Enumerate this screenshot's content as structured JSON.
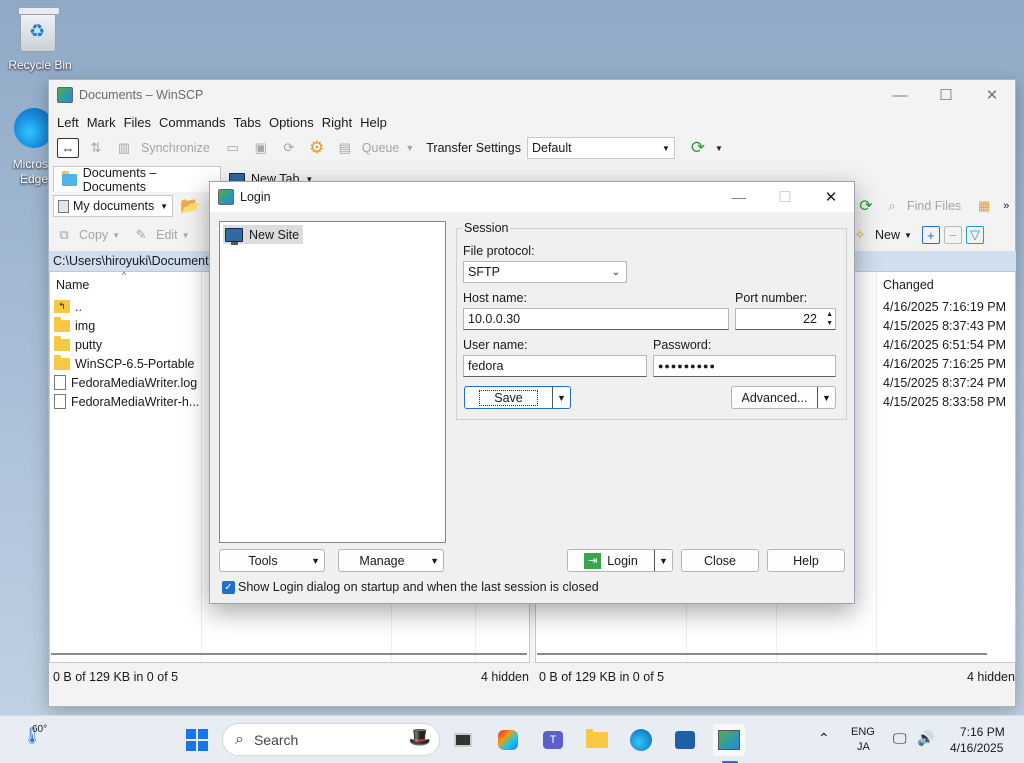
{
  "desktop": {
    "recycle_bin_label": "Recycle Bin",
    "edge_label_line1": "Micros",
    "edge_label_line2": "Edge"
  },
  "window": {
    "title": "Documents – WinSCP",
    "menu": [
      "Left",
      "Mark",
      "Files",
      "Commands",
      "Tabs",
      "Options",
      "Right",
      "Help"
    ],
    "toolbar": {
      "synchronize": "Synchronize",
      "queue": "Queue",
      "transfer_settings_label": "Transfer Settings",
      "transfer_settings_value": "Default"
    },
    "tabs": {
      "active": "Documents – Documents",
      "new_tab": "New Tab"
    },
    "left_panel": {
      "location": "My documents",
      "copy": "Copy",
      "edit": "Edit",
      "path": "C:\\Users\\hiroyuki\\Documents",
      "col_name": "Name",
      "files": [
        {
          "name": "..",
          "kind": "up"
        },
        {
          "name": "img",
          "kind": "folder"
        },
        {
          "name": "putty",
          "kind": "folder"
        },
        {
          "name": "WinSCP-6.5-Portable",
          "kind": "folder"
        },
        {
          "name": "FedoraMediaWriter.log",
          "kind": "file"
        },
        {
          "name": "FedoraMediaWriter-h...",
          "kind": "file"
        }
      ],
      "status": "0 B of 129 KB in 0 of 5",
      "hidden": "4 hidden"
    },
    "right_panel": {
      "find_files": "Find Files",
      "new": "New",
      "col_changed": "Changed",
      "changed": [
        "4/16/2025 7:16:19 PM",
        "4/15/2025 8:37:43 PM",
        "4/16/2025 6:51:54 PM",
        "4/16/2025 7:16:25 PM",
        "4/15/2025 8:37:24 PM",
        "4/15/2025 8:33:58 PM"
      ],
      "status": "0 B of 129 KB in 0 of 5",
      "hidden": "4 hidden"
    }
  },
  "login": {
    "title": "Login",
    "sites": [
      "New Site"
    ],
    "session_group": "Session",
    "file_protocol_label": "File protocol:",
    "file_protocol_value": "SFTP",
    "host_label": "Host name:",
    "host_value": "10.0.0.30",
    "port_label": "Port number:",
    "port_value": "22",
    "user_label": "User name:",
    "user_value": "fedora",
    "password_label": "Password:",
    "password_value": "●●●●●●●●●",
    "save": "Save",
    "advanced": "Advanced...",
    "tools": "Tools",
    "manage": "Manage",
    "login_btn": "Login",
    "close": "Close",
    "help": "Help",
    "show_login_checkbox": "Show Login dialog on startup and when the last session is closed",
    "show_login_checked": true
  },
  "taskbar": {
    "weather_temp": "60°",
    "search_placeholder": "Search",
    "lang_line1": "ENG",
    "lang_line2": "JA",
    "time": "7:16 PM",
    "date": "4/16/2025"
  },
  "colors": {
    "accent": "#1f6fd1",
    "path_bar": "#cfdff0",
    "folder": "#f6c844"
  }
}
